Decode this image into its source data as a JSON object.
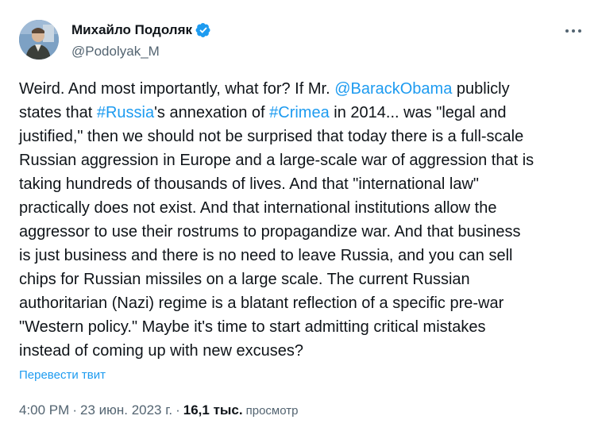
{
  "author": {
    "display_name": "Михайло Подоляк",
    "handle": "@Podolyak_M",
    "verified": true
  },
  "tweet": {
    "text_parts": [
      {
        "text": "Weird. And most importantly, what for? If Mr. ",
        "link": false
      },
      {
        "text": "@BarackObama",
        "link": true
      },
      {
        "text": " publicly\nstates that ",
        "link": false
      },
      {
        "text": "#Russia",
        "link": true
      },
      {
        "text": "'s annexation of ",
        "link": false
      },
      {
        "text": "#Crimea",
        "link": true
      },
      {
        "text": " in 2014... was \"legal and\njustified,\" then we should not be surprised that today there is a full-scale\nRussian aggression in Europe and a large-scale war of aggression that is\ntaking hundreds of thousands of lives. And that \"international law\"\npractically does not exist. And that international institutions allow the\naggressor to use their rostrums to propagandize war. And that business\nis just business and there is no need to leave Russia, and you can sell\nchips for Russian missiles on a large scale. The current Russian\nauthoritarian (Nazi) regime is a blatant reflection of a specific pre-war\n\"Western policy.\" Maybe it's time to start admitting critical mistakes\ninstead of coming up with new excuses?",
        "link": false
      }
    ],
    "translate_label": "Перевести твит"
  },
  "meta": {
    "time": "4:00 PM",
    "separator": "·",
    "date": "23 июн. 2023 г.",
    "views_count": "16,1 тыс.",
    "views_label": "просмотр"
  },
  "colors": {
    "link": "#1d9bf0",
    "secondary_text": "#536471",
    "primary_text": "#0f1419"
  },
  "icons": {
    "verified": "verified-badge-icon",
    "more": "more-options-icon"
  }
}
